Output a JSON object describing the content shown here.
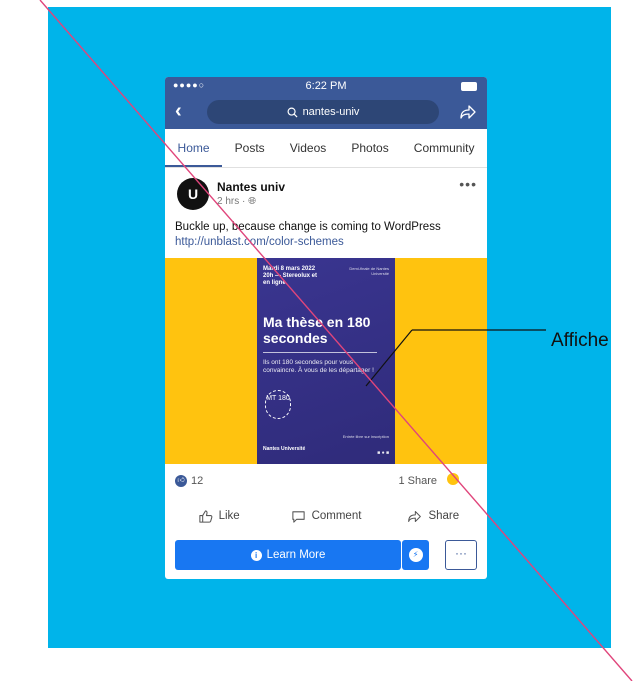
{
  "status_bar": {
    "time": "6:22 PM",
    "signal": "●●●●○"
  },
  "navbar": {
    "search_text": "nantes-univ"
  },
  "tabs": [
    {
      "label": "Home",
      "active": true
    },
    {
      "label": "Posts"
    },
    {
      "label": "Videos"
    },
    {
      "label": "Photos"
    },
    {
      "label": "Community"
    }
  ],
  "post": {
    "page_name": "Nantes univ",
    "avatar_text": "U",
    "time_ago": "2 hrs · ",
    "text": "Buckle up, because change is coming to WordPress",
    "link": "http://unblast.com/color-schemes",
    "reactions_count": "12",
    "shares": "1 Share"
  },
  "poster": {
    "date_line": "Mardi 8 mars 2022 20h — Stereolux et en ligne",
    "side_text": "Demi-finale de Nantes Université",
    "title": "Ma thèse en 180 secondes",
    "description": "Ils ont 180 secondes pour vous convaincre. À vous de les départager !",
    "badge": "MT 180",
    "footer_text": "Entrée libre sur inscription",
    "logo_text": "Nantes Université"
  },
  "actions": {
    "like": "Like",
    "comment": "Comment",
    "share": "Share"
  },
  "cta": {
    "learn_more": "Learn More",
    "more": "···"
  },
  "callout": {
    "label": "Affiche"
  },
  "colors": {
    "background": "#00b4ea",
    "facebook_blue": "#3b5998",
    "accent_yellow": "#ffc30f",
    "poster_purple": "#3a3590",
    "diagonal_line": "#e0457b"
  }
}
